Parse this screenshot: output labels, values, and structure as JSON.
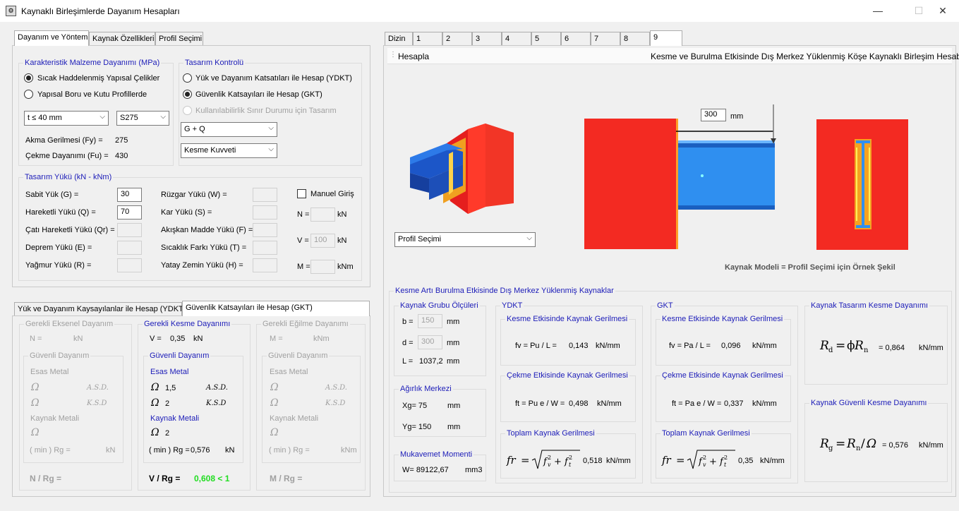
{
  "window": {
    "title": "Kaynaklı Birleşimlerde Dayanım Hesapları",
    "icon_name": "app-icon",
    "controls": {
      "minimize": "—",
      "maximize": "☐",
      "close": "✕"
    }
  },
  "left_tabs": [
    "Dayanım ve Yöntem",
    "Kaynak Özellikleri",
    "Profil Seçimi"
  ],
  "material": {
    "group_title": "Karakteristik Malzeme Dayanımı (MPa)",
    "options": [
      "Sıcak Haddelenmiş Yapısal Çelikler",
      "Yapısal Boru ve Kutu Profillerde"
    ],
    "thickness_select": "t ≤ 40 mm",
    "steel_select": "S275",
    "fy_label": "Akma Gerilmesi (Fy) =",
    "fy_value": "275",
    "fu_label": "Çekme Dayanımı (Fu) =",
    "fu_value": "430"
  },
  "design_control": {
    "group_title": "Tasarım Kontrolü",
    "options": [
      "Yük ve Dayanım Katsatıları ile Hesap (YDKT)",
      "Güvenlik Katsayıları ile Hesap (GKT)",
      "Kullanılabilirlik Sınır Durumu için Tasarım"
    ],
    "combo_select": "G + Q",
    "force_select": "Kesme Kuvveti"
  },
  "loads": {
    "group_title": "Tasarım Yükü (kN - kNm)",
    "left": [
      {
        "label": "Sabit Yük (G) =",
        "value": "30"
      },
      {
        "label": "Hareketli Yükü (Q) =",
        "value": "70"
      },
      {
        "label": "Çatı Hareketli Yükü (Qr) =",
        "value": ""
      },
      {
        "label": "Deprem Yükü (E) =",
        "value": ""
      },
      {
        "label": "Yağmur Yükü (R) =",
        "value": ""
      }
    ],
    "middle": [
      {
        "label": "Rüzgar Yükü (W) =",
        "value": ""
      },
      {
        "label": "Kar Yükü (S) =",
        "value": ""
      },
      {
        "label": "Akışkan Madde Yükü (F) =",
        "value": ""
      },
      {
        "label": "Sıcaklık Farkı Yükü (T) =",
        "value": ""
      },
      {
        "label": "Yatay Zemin Yükü (H) =",
        "value": ""
      }
    ],
    "manual_label": "Manuel Giriş",
    "n_label": "N =",
    "n_value": "",
    "n_unit": "kN",
    "v_label": "V =",
    "v_value": "100",
    "v_unit": "kN",
    "m_label": "M =",
    "m_value": "",
    "m_unit": "kNm"
  },
  "method_tabs": [
    "Yük ve Dayanım Kaysayılanlar ile Hesap (YDKT)",
    "Güvenlik Katsayıları ile Hesap (GKT)"
  ],
  "axial": {
    "title": "Gerekli Eksenel Dayanım",
    "n_label": "N =",
    "n_unit": "kN",
    "safe_title": "Güvenli Dayanım",
    "base_metal": "Esas Metal",
    "omega": "Ω",
    "asd": "A.S.D.",
    "ksd": "K.S.D",
    "weld_metal": "Kaynak Metali",
    "rg_label": "( min ) Rg =",
    "rg_unit": "kN",
    "ratio_label": "N / Rg ="
  },
  "shear": {
    "title": "Gerekli Kesme Dayanımı",
    "v_label": "V =",
    "v_value": "0,35",
    "v_unit": "kN",
    "safe_title": "Güvenli Dayanım",
    "base_metal": "Esas Metal",
    "omega": "Ω",
    "omega1": "1,5",
    "omega2": "2",
    "asd": "A.S.D.",
    "ksd": "K.S.D",
    "weld_metal": "Kaynak Metali",
    "omega3": "2",
    "rg_label": "( min ) Rg =",
    "rg_value": "0,576",
    "rg_unit": "kN",
    "ratio_label": "V / Rg =",
    "ratio_value": "0,608 < 1",
    "ratio_color": "#22dd22"
  },
  "moment": {
    "title": "Gerekli Eğilme Dayanımı",
    "m_label": "M =",
    "m_unit": "kNm",
    "safe_title": "Güvenli Dayanım",
    "base_metal": "Esas Metal",
    "omega": "Ω",
    "asd": "A.S.D.",
    "ksd": "K.S.D",
    "weld_metal": "Kaynak Metali",
    "rg_label": "( min ) Rg =",
    "rg_unit": "kNm",
    "ratio_label": "M / Rg ="
  },
  "right_tabs": [
    "Dizin",
    "1",
    "2",
    "3",
    "4",
    "5",
    "6",
    "7",
    "8",
    "9"
  ],
  "toolbar": {
    "calc_label": "Hesapla",
    "heading": "Kesme ve Burulma Etkisinde Dış Merkez Yüklenmiş Köşe Kaynaklı Birleşim Hesabı"
  },
  "figure": {
    "ecc_value": "300",
    "ecc_unit": "mm",
    "profile_select": "Profil Seçimi",
    "caption": "Kaynak Modeli = Profil Seçimi için Örnek Şekil"
  },
  "results": {
    "group_title": "Kesme Artı Burulma Etkisinde Dış Merkez Yüklenmiş Kaynaklar",
    "dims": {
      "title": "Kaynak Grubu Ölçüleri",
      "b_label": "b =",
      "b_value": "150",
      "b_unit": "mm",
      "d_label": "d =",
      "d_value": "300",
      "d_unit": "mm",
      "l_label": "L =",
      "l_value": "1037,2",
      "l_unit": "mm"
    },
    "centroid": {
      "title": "Ağırlık Merkezi",
      "xg": "Xg= 75",
      "xg_unit": "mm",
      "yg": "Yg= 150",
      "yg_unit": "mm"
    },
    "modulus": {
      "title": "Mukavemet Momenti",
      "w": "W= 89122,67",
      "w_unit": "mm3"
    },
    "ydkt": {
      "title": "YDKT",
      "shear_title": "Kesme Etkisinde Kaynak Gerilmesi",
      "fv_formula": "fv = Pu / L =",
      "fv_value": "0,143",
      "fv_unit": "kN/mm",
      "tension_title": "Çekme Etkisinde Kaynak Gerilmesi",
      "ft_formula": "ft = Pu e / W =",
      "ft_value": "0,498",
      "ft_unit": "kN/mm",
      "total_title": "Toplam Kaynak Gerilmesi",
      "fr_value": "0,518",
      "fr_unit": "kN/mm"
    },
    "gkt": {
      "title": "GKT",
      "shear_title": "Kesme Etkisinde Kaynak Gerilmesi",
      "fv_formula": "fv = Pa / L =",
      "fv_value": "0,096",
      "fv_unit": "kN/mm",
      "tension_title": "Çekme Etkisinde Kaynak Gerilmesi",
      "ft_formula": "ft = Pa e / W =",
      "ft_value": "0,337",
      "ft_unit": "kN/mm",
      "total_title": "Toplam Kaynak Gerilmesi",
      "fr_value": "0,35",
      "fr_unit": "kN/mm"
    },
    "design_strength": {
      "title": "Kaynak Tasarım Kesme Dayanımı",
      "value": "= 0,864",
      "unit": "kN/mm"
    },
    "safe_strength": {
      "title": "Kaynak Güvenli Kesme Dayanımı",
      "value": "= 0,576",
      "unit": "kN/mm"
    }
  }
}
